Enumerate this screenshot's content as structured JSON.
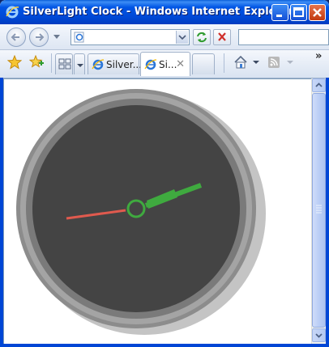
{
  "window": {
    "title": "SilverLight Clock - Windows Internet Explorer",
    "minimize_icon": "minimize-icon",
    "maximize_icon": "maximize-icon",
    "close_icon": "close-icon"
  },
  "address_bar": {
    "value": "",
    "placeholder": ""
  },
  "search_box": {
    "value": ""
  },
  "tabs": [
    {
      "label": "Silver...",
      "active": false
    },
    {
      "label": "Si...",
      "active": true
    }
  ],
  "clock": {
    "hour_hand_color": "#3faa3f",
    "minute_hand_color": "#3faa3f",
    "second_hand_color": "#e05a4e",
    "face_color": "#454545",
    "rim_color": "#9a9a9a"
  },
  "colors": {
    "titlebar": "#0055e5",
    "window_frame": "#0046d5"
  }
}
